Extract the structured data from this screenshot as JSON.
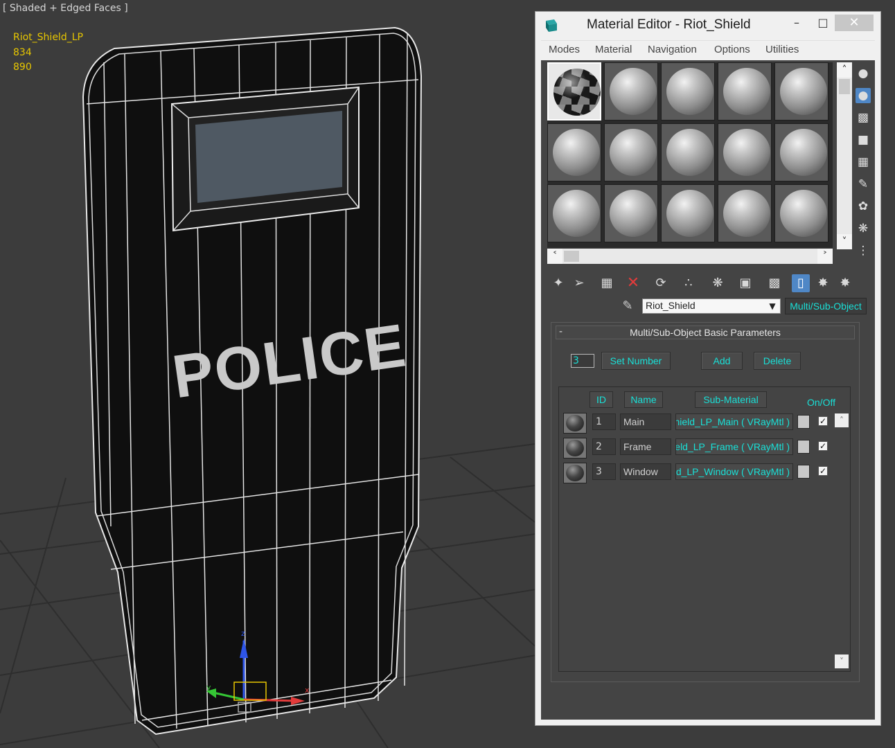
{
  "viewport": {
    "label": "[ Shaded + Edged Faces ]",
    "object_name": "Riot_Shield_LP",
    "stat_1": "834",
    "stat_2": "890",
    "shield_text": "POLICE",
    "gizmo": {
      "z": "z",
      "x": "x",
      "y": "y"
    },
    "colors": {
      "stats": "#e8c700",
      "wire": "#e6e6e6",
      "background": "#3c3c3c"
    }
  },
  "editor": {
    "title": "Material Editor - Riot_Shield",
    "window_buttons": {
      "minimize": "–",
      "maximize": "□",
      "close": "✕"
    },
    "menu": [
      "Modes",
      "Material",
      "Navigation",
      "Options",
      "Utilities"
    ],
    "slot_icons": [
      "sample-type-sphere-icon",
      "backlight-icon",
      "background-checker-icon",
      "sample-uv-tiling-icon",
      "video-color-check-icon",
      "make-preview-icon",
      "options-icon",
      "select-by-material-icon",
      "material-navigator-icon"
    ],
    "toolbar_icons": [
      "get-material-icon",
      "put-to-scene-icon",
      "assign-to-selection-icon",
      "delete-icon",
      "make-copy-icon",
      "make-unique-icon",
      "put-to-library-icon",
      "material-id-channel-icon",
      "show-map-in-viewport-icon",
      "show-end-result-icon",
      "go-to-parent-icon",
      "go-forward-to-sibling-icon"
    ],
    "material_name": "Riot_Shield",
    "material_type": "Multi/Sub-Object",
    "accent_color": "#19e0d7",
    "rollout": {
      "collapse_symbol": "-",
      "title": "Multi/Sub-Object Basic Parameters",
      "number_value": "3",
      "set_number_label": "Set Number",
      "add_label": "Add",
      "delete_label": "Delete",
      "headers": {
        "id": "ID",
        "name": "Name",
        "sub_material": "Sub-Material",
        "on_off": "On/Off"
      },
      "rows": [
        {
          "id": "1",
          "name": "Main",
          "sub_material": "hield_LP_Main  ( VRayMtl )",
          "on": true
        },
        {
          "id": "2",
          "name": "Frame",
          "sub_material": "eld_LP_Frame  ( VRayMtl )",
          "on": true
        },
        {
          "id": "3",
          "name": "Window",
          "sub_material": "d_LP_Window  ( VRayMtl )",
          "on": true
        }
      ]
    }
  }
}
